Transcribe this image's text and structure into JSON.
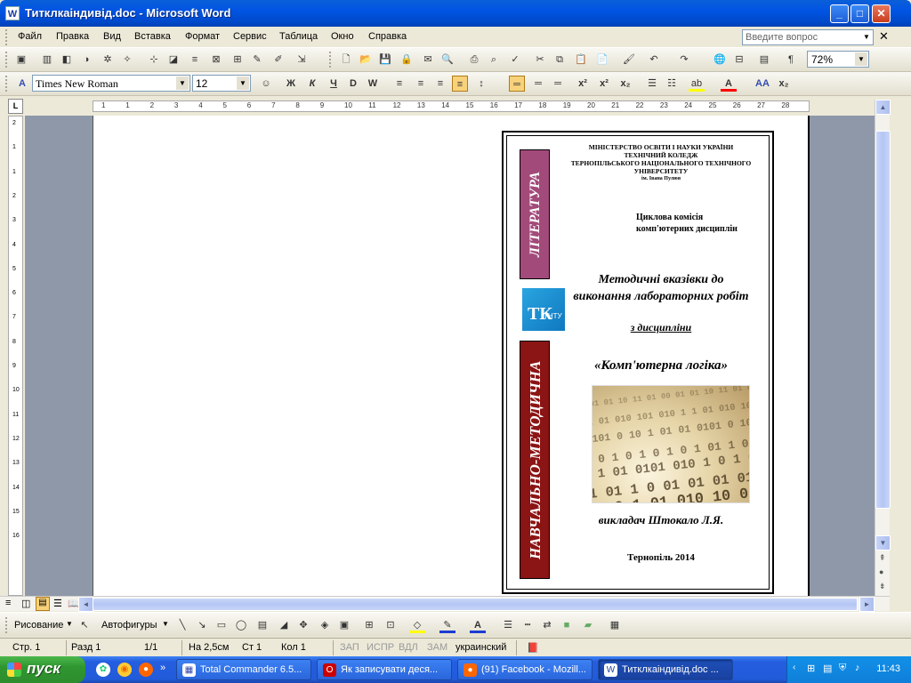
{
  "window": {
    "title": "Титклкаіндивід.doc - Microsoft Word"
  },
  "menu": [
    "Файл",
    "Правка",
    "Вид",
    "Вставка",
    "Формат",
    "Сервис",
    "Таблица",
    "Окно",
    "Справка"
  ],
  "ask": {
    "placeholder": "Введите вопрос"
  },
  "format": {
    "font": "Times New Roman",
    "size": "12",
    "bold": "Ж",
    "italic": "К",
    "underline": "Ч"
  },
  "zoom": "72%",
  "ruler": {
    "h_ticks": [
      "1",
      "1",
      "2",
      "3",
      "4",
      "5",
      "6",
      "7",
      "8",
      "9",
      "10",
      "11",
      "12",
      "13",
      "14",
      "15",
      "16",
      "17",
      "18",
      "19",
      "20",
      "21",
      "22",
      "23",
      "24",
      "25",
      "26",
      "27",
      "28"
    ],
    "v_ticks": [
      "2",
      "1",
      "1",
      "2",
      "3",
      "4",
      "5",
      "6",
      "7",
      "8",
      "9",
      "10",
      "11",
      "12",
      "13",
      "14",
      "15",
      "16"
    ]
  },
  "document": {
    "band_top": "ЛІТЕРАТУРА",
    "band_bottom": "НАВЧАЛЬНО-МЕТОДИЧНА",
    "ministry_lines": [
      "МІНІСТЕРСТВО ОСВІТИ І НАУКИ УКРАЇНИ",
      "ТЕХНІЧНИЙ КОЛЕДЖ",
      "ТЕРНОПІЛЬСЬКОГО НАЦІОНАЛЬНОГО ТЕХНІЧНОГО",
      "УНІВЕРСИТЕТУ"
    ],
    "ministry_sub": "ім. Івана Пулюя",
    "commission_lines": [
      "Циклова комісія",
      "комп'ютерних дисциплін"
    ],
    "methodical_lines": [
      "Методичні вказівки до",
      "виконання лабораторних робіт"
    ],
    "discipline": "з дисципліни",
    "subject": "«Комп'ютерна логіка»",
    "teacher": "викладач Штокало Л.Я.",
    "city": "Тернопіль  2014",
    "logo": "ТК",
    "logo_sub": "ТНТУ"
  },
  "drawing": {
    "draw_label": "Рисование",
    "autoshapes_label": "Автофигуры"
  },
  "status": {
    "page": "Стр.  1",
    "section": "Разд  1",
    "pages": "1/1",
    "at": "На  2,5см",
    "line": "Ст  1",
    "col": "Кол  1",
    "rec": "ЗАП",
    "trk": "ИСПР",
    "ext": "ВДЛ",
    "ovr": "ЗАМ",
    "lang": "украинский"
  },
  "taskbar": {
    "start": "пуск",
    "tasks": [
      "Total Commander 6.5...",
      "Як записувати деся...",
      "(91) Facebook - Mozill...",
      "Титклкаіндивід.doc ..."
    ],
    "clock": "11:43"
  }
}
